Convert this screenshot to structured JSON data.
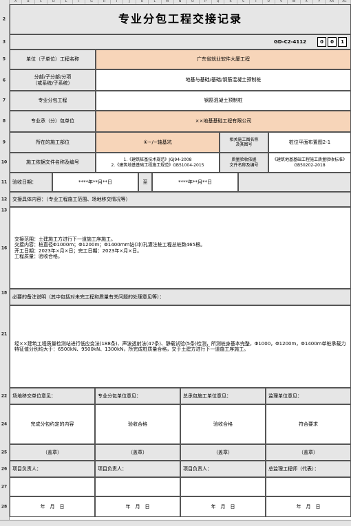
{
  "grid": {
    "columns": [
      "A",
      "B",
      "C",
      "D",
      "E",
      "F",
      "G",
      "H",
      "I",
      "J",
      "K",
      "L",
      "M",
      "N",
      "O",
      "P",
      "Q",
      "R",
      "S",
      "T",
      "U",
      "V",
      "W",
      "X",
      "Y",
      "AA",
      "AC"
    ],
    "rows": [
      "2",
      "3",
      "5",
      "6",
      "7",
      "8",
      "9",
      "10",
      "11",
      "12",
      "13",
      "14",
      "15",
      "16",
      "17",
      "18",
      "19",
      "20",
      "21",
      "22",
      "23",
      "24",
      "25",
      "26",
      "27",
      "28"
    ]
  },
  "form": {
    "title": "专业分包工程交接记录",
    "code_label": "GD-C2-4112",
    "code_boxes": [
      "0",
      "0",
      "1"
    ],
    "fields": {
      "unit_project_label": "单位（子单位）工程名称",
      "unit_project_value": "广东省就业软件大厦工程",
      "sub_division_label": "分部/子分部/分项\n（或系统/子系统）",
      "sub_division_value": "地基与基础/基础/钢筋混凝土预制桩",
      "sub_project_label": "专业分包工程",
      "sub_project_value": "钢筋混凝土预制桩",
      "contractor_label": "专业承（分）包单位",
      "contractor_value": "××地基基础工程有限公司",
      "location_label": "所在的施工部位",
      "location_value": "①~/~轴基坑",
      "drawing_label": "相关施工图名称\n及其图号",
      "drawing_value": "桩位平面布置图2-1",
      "basis_label": "施工依据文件名称及编号",
      "basis_value": "1.《建筑桩基技术规范》JGJ94-2008\n2.《建筑地基基础工程施工规范》GB51004-2015",
      "quality_label": "质量验收依据\n文件名称及编号",
      "quality_value": "《建筑地基基础工程施工质量验收标准》\nGB50202-2018",
      "accept_date_label": "验收日期：",
      "accept_date_from": "****年**月**日",
      "accept_date_sep": "至",
      "accept_date_to": "****年**月**日"
    },
    "handover": {
      "heading": "交接具体内容：（专业工程施工范围、场地移交情况等）",
      "body": "交接范围：土建施工方进行下一道施工序施工。\n交接内容：桩直径Φ1000m；Φ1200m；Φ1400mm钻(冲)孔灌注桩工程总桩数465根。\n开工日期：2023年×月×日；完工日期：2023年×月×日。\n工程质量：验收合格。"
    },
    "notes": {
      "heading": "必要的备注说明（其中包括对未完工程和质量有关问题的处理意见等）：",
      "body": "经××建筑工程质量检测站进行低应变法(188条)、声波透射法(47条)、静载试验(5条)检测，所测桩身基本完整，Φ1000，Φ1200m，Φ1400m单桩承载力特征值分别均大于：6500kN、9500kN、1300kN，所完成桩质量合格，交于土建方进行下一道施工序施工。"
    },
    "opinions": [
      {
        "label": "场地移交单位意见：",
        "value": "完成分包约定的内容",
        "seal": "（盖章）",
        "person": "项目负责人：",
        "date": "年　月　日"
      },
      {
        "label": "专业分包单位意见：",
        "value": "验收合格",
        "seal": "（盖章）",
        "person": "项目负责人：",
        "date": "年　月　日"
      },
      {
        "label": "总承包施工单位意见：",
        "value": "验收合格",
        "seal": "（盖章）",
        "person": "项目负责人：",
        "date": "年　月　日"
      },
      {
        "label": "监理单位意见：",
        "value": "符合要求",
        "seal": "（盖章）",
        "person": "总监理工程师（代表）：",
        "date": "年　月　日"
      }
    ]
  }
}
